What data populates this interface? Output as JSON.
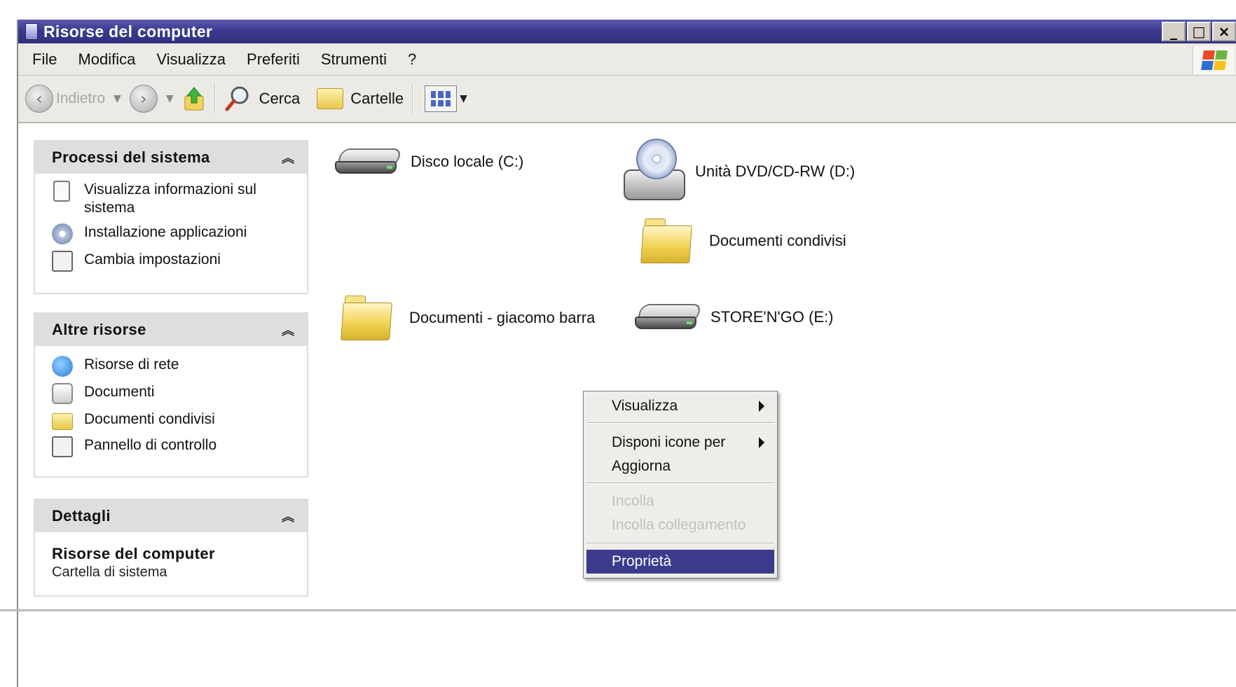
{
  "window": {
    "title": "Risorse del computer",
    "controls": [
      "minimize",
      "maximize",
      "close"
    ]
  },
  "menubar": {
    "items": [
      "File",
      "Modifica",
      "Visualizza",
      "Preferiti",
      "Strumenti",
      "?"
    ]
  },
  "toolbar": {
    "back_label": "Indietro",
    "search_label": "Cerca",
    "folders_label": "Cartelle"
  },
  "panes": {
    "system": {
      "title": "Processi del sistema",
      "tasks": [
        {
          "label": "Visualizza informazioni sul sistema",
          "icon": "document-icon"
        },
        {
          "label": "Installazione applicazioni",
          "icon": "cd-install-icon"
        },
        {
          "label": "Cambia impostazioni",
          "icon": "control-panel-icon"
        }
      ]
    },
    "other": {
      "title": "Altre risorse",
      "tasks": [
        {
          "label": "Risorse di rete",
          "icon": "network-icon"
        },
        {
          "label": "Documenti",
          "icon": "documents-icon"
        },
        {
          "label": "Documenti condivisi",
          "icon": "folder-icon"
        },
        {
          "label": "Pannello di controllo",
          "icon": "control-panel-icon"
        }
      ]
    },
    "details": {
      "title": "Dettagli",
      "name": "Risorse del computer",
      "type": "Cartella di sistema"
    }
  },
  "items": [
    {
      "label": "Disco locale (C:)",
      "icon": "hard-drive-icon"
    },
    {
      "label": "Unità DVD/CD-RW (D:)",
      "icon": "cd-drive-icon"
    },
    {
      "label": "Documenti condivisi",
      "icon": "folder-icon"
    },
    {
      "label": "Documenti - giacomo barra",
      "icon": "folder-icon"
    },
    {
      "label": "STORE'N'GO (E:)",
      "icon": "removable-drive-icon"
    }
  ],
  "context_menu": {
    "items": [
      {
        "label": "Visualizza",
        "submenu": true,
        "enabled": true
      },
      {
        "label": "Disponi icone per",
        "submenu": true,
        "enabled": true
      },
      {
        "label": "Aggiorna",
        "submenu": false,
        "enabled": true
      },
      {
        "label": "Incolla",
        "submenu": false,
        "enabled": false
      },
      {
        "label": "Incolla collegamento",
        "submenu": false,
        "enabled": false
      },
      {
        "label": "Proprietà",
        "submenu": false,
        "enabled": true,
        "selected": true
      }
    ]
  },
  "colors": {
    "titlebar": "#3b3a8e",
    "selection": "#3c3a8c",
    "chrome": "#eceae4"
  }
}
